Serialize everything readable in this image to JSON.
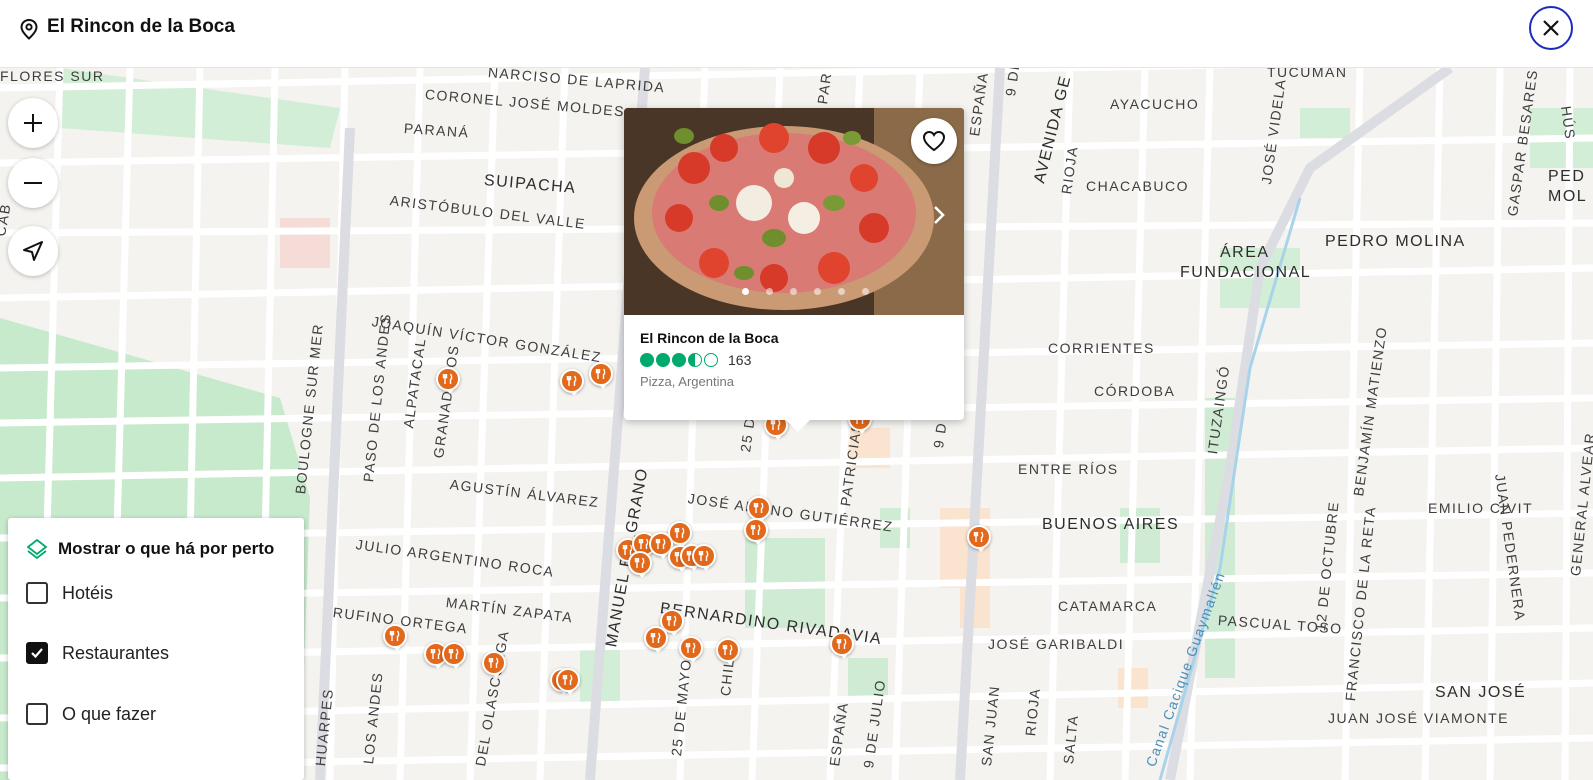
{
  "header": {
    "title": "El Rincon de la Boca"
  },
  "icons": {
    "location": "location-pin-icon",
    "close": "close-icon",
    "zoom_in": "plus-icon",
    "zoom_out": "minus-icon",
    "locate": "navigation-arrow-icon",
    "favorite": "heart-icon",
    "next": "chevron-right-icon",
    "layers": "layers-icon",
    "restaurant": "fork-knife-icon"
  },
  "colors": {
    "accent_close": "#1a2bbd",
    "marker": "#e2691b",
    "rating": "#00aa6c",
    "park": "#bfe6c5",
    "block": "#f4f3ef",
    "road": "#ffffff"
  },
  "popup": {
    "name": "El Rincon de la Boca",
    "rating": 3.5,
    "review_count": "163",
    "cuisine": "Pizza, Argentina",
    "photo_count": 6,
    "active_photo": 0
  },
  "nearby": {
    "title": "Mostrar o que há por perto",
    "options": [
      {
        "label": "Hotéis",
        "checked": false
      },
      {
        "label": "Restaurantes",
        "checked": true
      },
      {
        "label": "O que fazer",
        "checked": false
      }
    ]
  },
  "streets": [
    "FLORES SUR",
    "NARCISO DE LAPRIDA",
    "CORONEL JOSÉ MOLDES",
    "PARANÁ",
    "SUIPACHA",
    "ARISTÓBULO DEL VALLE",
    "JOAQUÍN VÍCTOR GONZÁLEZ",
    "ALPATACAL",
    "GRANADEROS",
    "PASO DE LOS ANDES",
    "BOULOGNE SUR MER",
    "AGUSTÍN ÁLVAREZ",
    "JULIO ARGENTINO ROCA",
    "MARTÍN ZAPATA",
    "RUFINO ORTEGA",
    "LOS ANDES",
    "HUARPES",
    "DEL OLASCOAGA",
    "MANUEL BELGRANO",
    "25 DE MAYO",
    "CHILE",
    "BERNARDINO RIVADAVIA",
    "JOSÉ ALBINO GUTIÉRREZ",
    "PATRICIAS",
    "ESPAÑA",
    "9 DE JULIO",
    "25 D",
    "9 D",
    "PAR",
    "ESPAÑA",
    "9 DE",
    "AVENIDA GE",
    "AYACUCHO",
    "CHACABUCO",
    "RIOJA",
    "JOSÉ VIDELA",
    "TUCUMÁN",
    "ÁREA",
    "FUNDACIONAL",
    "PEDRO MOLINA",
    "GASPAR BESARES",
    "PED",
    "MOL",
    "CORRIENTES",
    "CÓRDOBA",
    "ENTRE RÍOS",
    "BUENOS AIRES",
    "CATAMARCA",
    "JOSÉ GARIBALDI",
    "ITUZAINGÓ",
    "BENJAMÍN MATIENZO",
    "JUAN PEDERNERA",
    "12 DE OCTUBRE",
    "FRANCISCO DE LA RETA",
    "PASCUAL TOSO",
    "EMILIO CIVIT",
    "SAN JOSÉ",
    "JUAN JOSÉ VIAMONTE",
    "Canal Cacique Guaymallén",
    "GENERAL ALVEAR",
    "SALTA",
    "SAN JUAN",
    "RIOJA",
    "CAB",
    "HÚS"
  ]
}
